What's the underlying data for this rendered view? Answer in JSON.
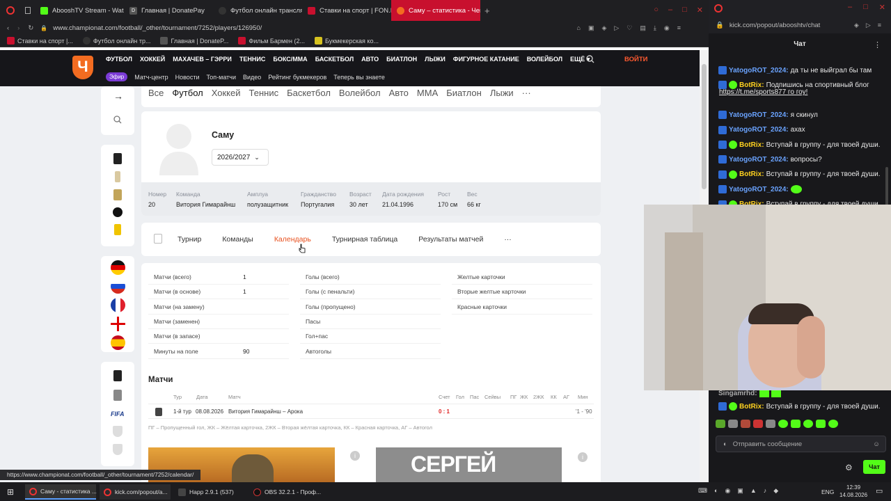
{
  "browser": {
    "tabs": [
      {
        "label": "AbooshTV Stream - Watch",
        "color": "#53fc18"
      },
      {
        "label": "Главная | DonatePay",
        "color": "#444"
      },
      {
        "label": "Футбол онлайн трансляц",
        "color": "#2b2b2b"
      },
      {
        "label": "Ставки на спорт | FON.BE",
        "color": "#c8102e"
      },
      {
        "label": "Саму – статистика - Чемп",
        "color": "#c8102e"
      }
    ],
    "url": "www.championat.com/football/_other/tournament/7252/players/126950/",
    "bookmarks": [
      "Ставки на спорт |...",
      "Футбол онлайн тр...",
      "Главная | DonateP...",
      "Фильм Бармен (2...",
      "Букмекерская ко..."
    ],
    "status_url": "https://www.championat.com/football/_other/tournament/7252/calendar/"
  },
  "site": {
    "logo": "Ч",
    "nav": [
      "ФУТБОЛ",
      "ХОККЕЙ",
      "МАХАЧЕВ – ГЭРРИ",
      "ТЕННИС",
      "БОКС/ММА",
      "БАСКЕТБОЛ",
      "АВТО",
      "БИАТЛОН",
      "ЛЫЖИ",
      "ФИГУРНОЕ КАТАНИЕ",
      "ВОЛЕЙБОЛ",
      "ЕЩЁ"
    ],
    "live": "Эфир",
    "subnav": [
      "Матч-центр",
      "Новости",
      "Топ-матчи",
      "Видео",
      "Рейтинг букмекеров",
      "Теперь вы знаете"
    ],
    "login": "ВОЙТИ"
  },
  "sports": [
    "Все",
    "Футбол",
    "Хоккей",
    "Теннис",
    "Баскетбол",
    "Волейбол",
    "Авто",
    "ММА",
    "Биатлон",
    "Лыжи"
  ],
  "player": {
    "name": "Саму",
    "season": "2026/2027",
    "fields": [
      {
        "label": "Номер",
        "value": "20"
      },
      {
        "label": "Команда",
        "value": "Витория Гимарайнш"
      },
      {
        "label": "Амплуа",
        "value": "полузащитник"
      },
      {
        "label": "Гражданство",
        "value": "Португалия"
      },
      {
        "label": "Возраст",
        "value": "30 лет"
      },
      {
        "label": "Дата рождения",
        "value": "21.04.1996"
      },
      {
        "label": "Рост",
        "value": "170 см"
      },
      {
        "label": "Вес",
        "value": "66 кг"
      }
    ]
  },
  "tourtabs": [
    "Турнир",
    "Команды",
    "Календарь",
    "Турнирная таблица",
    "Результаты матчей"
  ],
  "stats": {
    "col1": [
      {
        "label": "Матчи (всего)",
        "value": "1"
      },
      {
        "label": "Матчи (в основе)",
        "value": "1"
      },
      {
        "label": "Матчи (на замену)",
        "value": ""
      },
      {
        "label": "Матчи (заменен)",
        "value": ""
      },
      {
        "label": "Матчи (в запасе)",
        "value": ""
      },
      {
        "label": "Минуты на поле",
        "value": "90"
      }
    ],
    "col2": [
      "Голы (всего)",
      "Голы (с пенальти)",
      "Голы (пропущено)",
      "Пасы",
      "Гол+пас",
      "Автоголы"
    ],
    "col3": [
      "Желтые карточки",
      "Вторые желтые карточки",
      "Красные карточки"
    ]
  },
  "matches": {
    "title": "Матчи",
    "headers": [
      "Тур",
      "Дата",
      "Матч",
      "Счет",
      "Гол",
      "Пас",
      "Сейвы",
      "ПГ",
      "ЖК",
      "2ЖК",
      "КК",
      "АГ",
      "Мин"
    ],
    "row": {
      "tour": "1-й тур",
      "date": "08.08.2026",
      "match": "Витория Гимарайнш – Арока",
      "score": "0 : 1",
      "min": "'1 - '90"
    },
    "legend": "ПГ – Пропущенный гол, ЖК – Жёлтая карточка, 2ЖК – Вторая жёлтая карточка, КК – Красная карточка, АГ – Автогол"
  },
  "promo_text": "СЕРГЕЙ",
  "chat": {
    "url": "kick.com/popout/abooshtv/chat",
    "title": "Чат",
    "messages": [
      {
        "user": "YatogoROT_2024:",
        "text": "да ты не выйграл бы там",
        "bot": false
      },
      {
        "user": "BotRix:",
        "text": "Подпишись на спортивный блог",
        "bot": true
      },
      {
        "user": "",
        "text": "https://t.me/sports877 го гоу!",
        "bot": false,
        "link": true
      },
      {
        "user": "YatogoROT_2024:",
        "text": "я скинул",
        "bot": false
      },
      {
        "user": "YatogoROT_2024:",
        "text": "ахах",
        "bot": false
      },
      {
        "user": "BotRix:",
        "text": "Вступай в группу - для твоей души.",
        "bot": true
      },
      {
        "user": "YatogoROT_2024:",
        "text": "вопросы?",
        "bot": false
      },
      {
        "user": "BotRix:",
        "text": "Вступай в группу - для твоей души.",
        "bot": true
      },
      {
        "user": "YatogoROT_2024:",
        "text": "",
        "bot": false
      },
      {
        "user": "BotRix:",
        "text": "Вступай в группу - для твоей души.",
        "bot": true
      }
    ],
    "lower_user": "Singamrhd:",
    "lower_bot": {
      "user": "BotRix:",
      "text": "Вступай в группу - для твоей души."
    },
    "input_placeholder": "Отправить сообщение",
    "send_label": "Чат"
  },
  "taskbar": {
    "items": [
      "Саму - статистика ...",
      "kick.com/popout/a...",
      "Happ 2.9.1 (537)",
      "OBS 32.2.1 - Проф..."
    ],
    "lang": "ENG",
    "time": "12:39",
    "date": "14.08.2026"
  }
}
